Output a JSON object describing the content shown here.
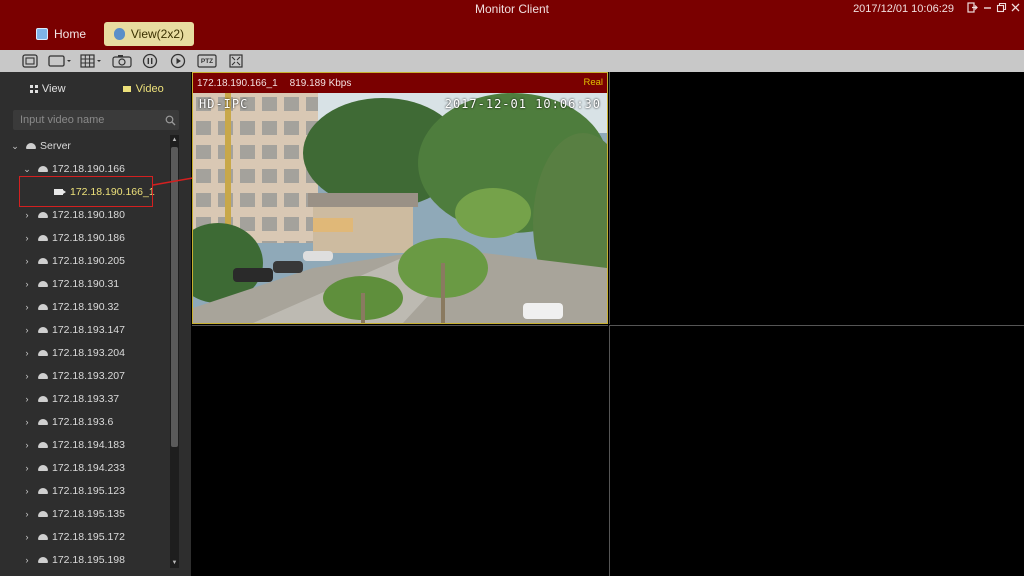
{
  "app": {
    "title": "Monitor Client",
    "datetime": "2017/12/01 10:06:29",
    "tabs": [
      {
        "label": "Home",
        "active": false
      },
      {
        "label": "View(2x2)",
        "active": true
      }
    ]
  },
  "toolbar": {
    "items": [
      "record-icon",
      "window-layout-icon",
      "grid-layout-icon",
      "snapshot-icon",
      "pause-icon",
      "play-icon",
      "ptz-icon",
      "fullscreen-icon"
    ],
    "ptz_label": "PTZ"
  },
  "sidebar": {
    "tabs": [
      {
        "label": "View",
        "active": false
      },
      {
        "label": "Video",
        "active": true
      }
    ],
    "search_placeholder": "Input video name",
    "tree": {
      "root": "Server",
      "expanded_device": "172.18.190.166",
      "selected_channel": "172.18.190.166_1",
      "devices": [
        "172.18.190.180",
        "172.18.190.186",
        "172.18.190.205",
        "172.18.190.31",
        "172.18.190.32",
        "172.18.193.147",
        "172.18.193.204",
        "172.18.193.207",
        "172.18.193.37",
        "172.18.193.6",
        "172.18.194.183",
        "172.18.194.233",
        "172.18.195.123",
        "172.18.195.135",
        "172.18.195.172",
        "172.18.195.198"
      ]
    }
  },
  "view": {
    "layout": "2x2",
    "panes": [
      {
        "camera": "172.18.190.166_1",
        "bitrate": "819.189 Kbps",
        "status": "Real",
        "osd_left": "HD-IPC",
        "osd_right": "2017-12-01  10:06:30"
      }
    ]
  },
  "colors": {
    "title_bar": "#7a0000",
    "active_tab": "#e8dca0",
    "selected_text": "#ece07a",
    "status_real": "#e0c000",
    "annotation": "#d42020"
  }
}
